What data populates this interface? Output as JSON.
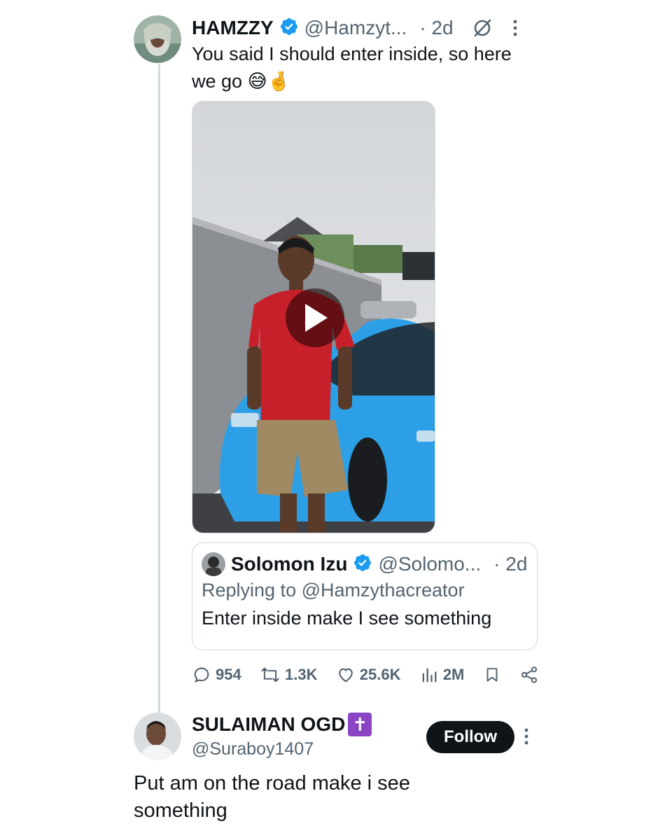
{
  "tweet": {
    "name": "HAMZZY",
    "handle": "@Hamzyt...",
    "time": "· 2d",
    "text": "You said I should enter inside, so here we go",
    "emoji": "😅🤞",
    "media": {
      "type": "video"
    }
  },
  "quote": {
    "name": "Solomon Izu",
    "handle": "@Solomo...",
    "time": "· 2d",
    "replying_to": "Replying to @Hamzythacreator",
    "text": "Enter inside make I see something"
  },
  "metrics": {
    "replies": "954",
    "reposts": "1.3K",
    "likes": "25.6K",
    "views": "2M"
  },
  "reply": {
    "name": "SULAIMAN OGD",
    "name_badge": "✝",
    "handle": "@Suraboy1407",
    "follow_label": "Follow",
    "text": "Put am on the road make i see something"
  },
  "colors": {
    "verified": "#1d9bf0",
    "secondary": "#536471",
    "car_blue": "#2d9fe6",
    "shirt_red": "#c8202a"
  }
}
